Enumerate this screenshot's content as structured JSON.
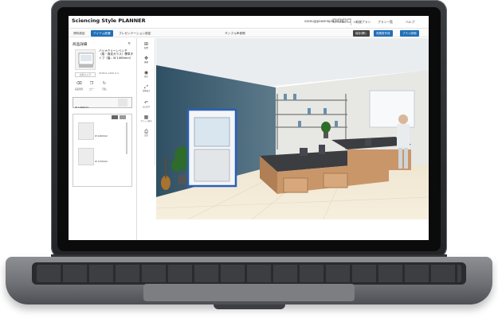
{
  "app": {
    "title": "Sciencing Style PLANNER"
  },
  "account": {
    "email": "ssaeu@powerwplan.co.jp",
    "new_plan": "+新規プラン",
    "plan_list": "プラン一覧",
    "help": "ヘルプ"
  },
  "nav": {
    "tabs": [
      "資料設定",
      "アイテム配置",
      "プレゼンテーション設定"
    ],
    "sample": "サンプル声参照",
    "pills": [
      "保存/開く",
      "見積書作成",
      "プラン詳細"
    ]
  },
  "sidebar": {
    "header": "商品詳細",
    "product_name": "バイオクリーンベンチ（縦・強化ガラス）標準タイプ（幅：W 1460mm）",
    "product_sub": "ST-BCS-1460-S-Ⅱ",
    "small_button": "お気に入り",
    "actions": [
      "商品削除",
      "コピー",
      "回転"
    ],
    "variant_label": "W 1460mm",
    "list_items": [
      "W 1460mm",
      "W 1750mm"
    ]
  },
  "tools": [
    "配置",
    "移動",
    "視点",
    "全体表示",
    "元に戻す",
    "グリッド表示",
    "出力"
  ],
  "colors": {
    "accent": "#1f6fb8",
    "laptop": "#3a3c40"
  }
}
